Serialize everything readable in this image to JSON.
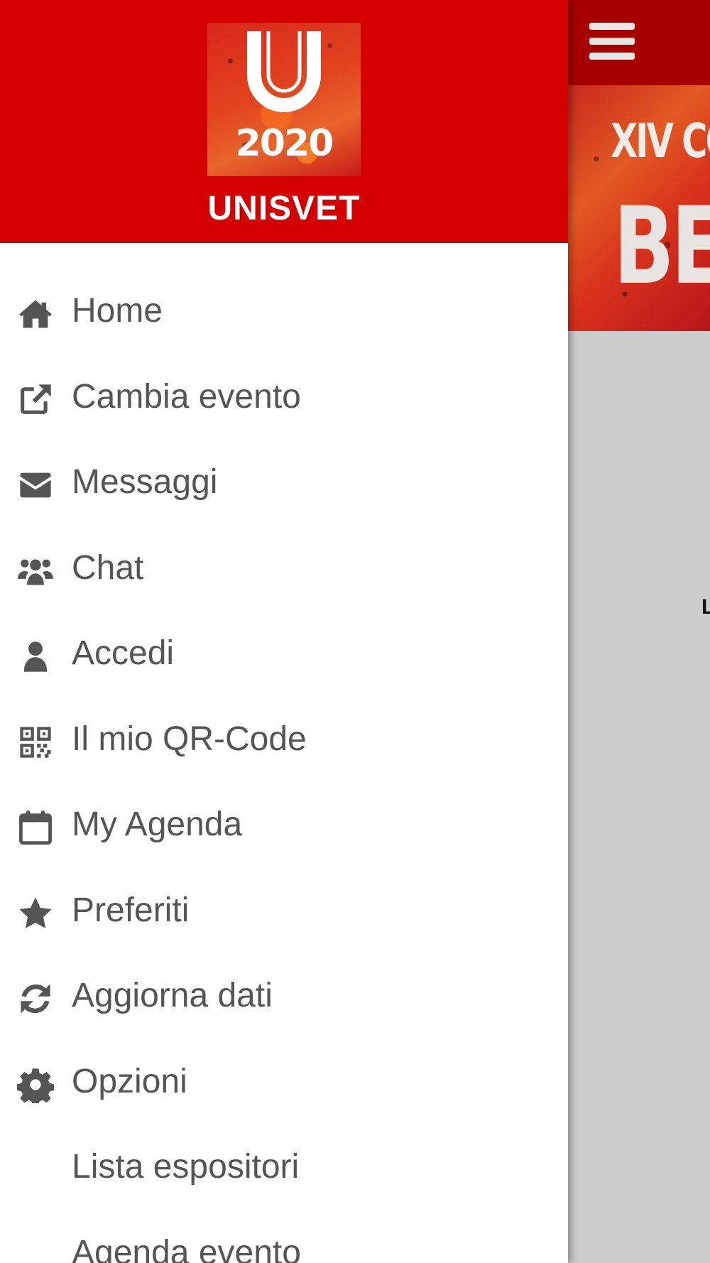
{
  "drawer": {
    "brand": {
      "year": "2020",
      "name": "UNISVET"
    },
    "items": [
      {
        "label": "Home",
        "icon": "home-icon"
      },
      {
        "label": "Cambia evento",
        "icon": "external-link-icon"
      },
      {
        "label": "Messaggi",
        "icon": "envelope-icon"
      },
      {
        "label": "Chat",
        "icon": "users-icon"
      },
      {
        "label": "Accedi",
        "icon": "user-icon"
      },
      {
        "label": "Il mio QR-Code",
        "icon": "qrcode-icon"
      },
      {
        "label": "My Agenda",
        "icon": "calendar-icon"
      },
      {
        "label": "Preferiti",
        "icon": "star-icon"
      },
      {
        "label": "Aggiorna dati",
        "icon": "refresh-icon"
      },
      {
        "label": "Opzioni",
        "icon": "gear-icon"
      },
      {
        "label": "Lista espositori",
        "icon": ""
      },
      {
        "label": "Agenda evento",
        "icon": ""
      }
    ]
  },
  "app": {
    "banner": {
      "line1": "XIV CO",
      "line2": "BE"
    },
    "peek_text": "L"
  },
  "colors": {
    "drawer_header": "#d40000",
    "app_header": "#a60000",
    "menu_text": "#555555",
    "app_background": "#cccccc"
  }
}
